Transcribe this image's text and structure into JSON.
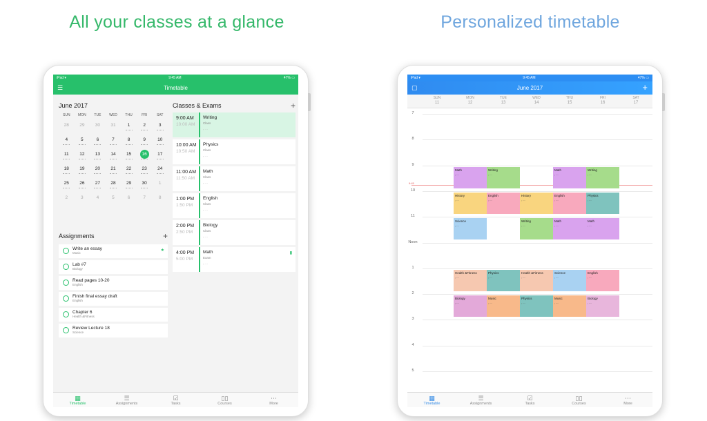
{
  "headlines": {
    "left": "All your classes at a glance",
    "right": "Personalized timetable"
  },
  "left_app": {
    "status": {
      "carrier": "iPad ▾",
      "time": "9:45 AM",
      "battery": "47% ▭"
    },
    "title": "Timetable",
    "calendar": {
      "title": "June 2017",
      "weekdays": [
        "SUN",
        "MON",
        "TUE",
        "WED",
        "THU",
        "FRI",
        "SAT"
      ],
      "days": [
        {
          "d": "28",
          "m": true
        },
        {
          "d": "29",
          "m": true
        },
        {
          "d": "30",
          "m": true
        },
        {
          "d": "31",
          "m": true
        },
        {
          "d": "1"
        },
        {
          "d": "2"
        },
        {
          "d": "3"
        },
        {
          "d": "4"
        },
        {
          "d": "5"
        },
        {
          "d": "6"
        },
        {
          "d": "7"
        },
        {
          "d": "8"
        },
        {
          "d": "9"
        },
        {
          "d": "10"
        },
        {
          "d": "11"
        },
        {
          "d": "12"
        },
        {
          "d": "13"
        },
        {
          "d": "14"
        },
        {
          "d": "15"
        },
        {
          "d": "16",
          "sel": true
        },
        {
          "d": "17"
        },
        {
          "d": "18"
        },
        {
          "d": "19"
        },
        {
          "d": "20"
        },
        {
          "d": "21"
        },
        {
          "d": "22"
        },
        {
          "d": "23"
        },
        {
          "d": "24"
        },
        {
          "d": "25"
        },
        {
          "d": "26"
        },
        {
          "d": "27"
        },
        {
          "d": "28"
        },
        {
          "d": "29"
        },
        {
          "d": "30"
        },
        {
          "d": "1",
          "m": true
        },
        {
          "d": "2",
          "m": true
        },
        {
          "d": "3",
          "m": true
        },
        {
          "d": "4",
          "m": true
        },
        {
          "d": "5",
          "m": true
        },
        {
          "d": "6",
          "m": true
        },
        {
          "d": "7",
          "m": true
        },
        {
          "d": "8",
          "m": true
        }
      ]
    },
    "assignments_title": "Assignments",
    "assignments": [
      {
        "title": "Write an essay",
        "sub": "Music",
        "flag": true
      },
      {
        "title": "Lab #7",
        "sub": "Biology"
      },
      {
        "title": "Read pages 10-20",
        "sub": "English"
      },
      {
        "title": "Finish final essay draft",
        "sub": "English"
      },
      {
        "title": "Chapter 6",
        "sub": "Health &Fitness"
      },
      {
        "title": "Review Lecture 18",
        "sub": "Science"
      }
    ],
    "classes_title": "Classes & Exams",
    "classes": [
      {
        "time": "9:00 AM",
        "end": "10:00 AM",
        "name": "Writing",
        "type": "Class",
        "hl": true
      },
      {
        "time": "10:00 AM",
        "end": "10:50 AM",
        "name": "Physics",
        "type": "Class"
      },
      {
        "time": "11:00 AM",
        "end": "11:50 AM",
        "name": "Math",
        "type": "Class"
      },
      {
        "time": "1:00 PM",
        "end": "1:50 PM",
        "name": "English",
        "type": "Class"
      },
      {
        "time": "2:00 PM",
        "end": "2:50 PM",
        "name": "Biology",
        "type": "Class"
      },
      {
        "time": "4:00 PM",
        "end": "5:00 PM",
        "name": "Math",
        "type": "Exam",
        "flag": true
      }
    ],
    "tabs": [
      "Timetable",
      "Assignments",
      "Tasks",
      "Courses",
      "More"
    ]
  },
  "right_app": {
    "status": {
      "carrier": "iPad ▾",
      "time": "9:45 AM",
      "battery": "47% ▭"
    },
    "title": "June 2017",
    "weekdays": [
      {
        "n": "SUN",
        "d": "11"
      },
      {
        "n": "MON",
        "d": "12"
      },
      {
        "n": "TUE",
        "d": "13"
      },
      {
        "n": "WED",
        "d": "14"
      },
      {
        "n": "THU",
        "d": "15"
      },
      {
        "n": "FRI",
        "d": "16"
      },
      {
        "n": "SAT",
        "d": "17"
      }
    ],
    "hours": [
      "7",
      "8",
      "9",
      "10",
      "11",
      "Noon",
      "1",
      "2",
      "3",
      "4",
      "5"
    ],
    "now_label": "9:45",
    "blocks": [
      {
        "n": "Math",
        "col": 1,
        "row": 2,
        "c": "#d9a3ee"
      },
      {
        "n": "Writing",
        "col": 2,
        "row": 2,
        "c": "#a6dc8b"
      },
      {
        "n": "Math",
        "col": 4,
        "row": 2,
        "c": "#d9a3ee"
      },
      {
        "n": "Writing",
        "col": 5,
        "row": 2,
        "c": "#a6dc8b"
      },
      {
        "n": "History",
        "col": 1,
        "row": 3,
        "c": "#f9d57f"
      },
      {
        "n": "English",
        "col": 2,
        "row": 3,
        "c": "#f8a9bd"
      },
      {
        "n": "History",
        "col": 3,
        "row": 3,
        "c": "#f9d57f"
      },
      {
        "n": "English",
        "col": 4,
        "row": 3,
        "c": "#f8a9bd"
      },
      {
        "n": "Physics",
        "col": 5,
        "row": 3,
        "c": "#7fc3be"
      },
      {
        "n": "Science",
        "col": 1,
        "row": 4,
        "c": "#a9d2f2"
      },
      {
        "n": "Writing",
        "col": 3,
        "row": 4,
        "c": "#a6dc8b"
      },
      {
        "n": "Math",
        "col": 4,
        "row": 4,
        "c": "#d9a3ee"
      },
      {
        "n": "Math",
        "col": 5,
        "row": 4,
        "c": "#d9a3ee"
      },
      {
        "n": "Health &Fitness",
        "col": 1,
        "row": 6,
        "c": "#f6c8b0"
      },
      {
        "n": "Physics",
        "col": 2,
        "row": 6,
        "c": "#7fc3be"
      },
      {
        "n": "Health &Fitness",
        "col": 3,
        "row": 6,
        "c": "#f6c8b0"
      },
      {
        "n": "Science",
        "col": 4,
        "row": 6,
        "c": "#a9d2f2"
      },
      {
        "n": "English",
        "col": 5,
        "row": 6,
        "c": "#f8a9bd"
      },
      {
        "n": "Biology",
        "col": 1,
        "row": 7,
        "c": "#e3a9d9"
      },
      {
        "n": "Music",
        "col": 2,
        "row": 7,
        "c": "#f8b98a"
      },
      {
        "n": "Physics",
        "col": 3,
        "row": 7,
        "c": "#7fc3be"
      },
      {
        "n": "Music",
        "col": 4,
        "row": 7,
        "c": "#f8b98a"
      },
      {
        "n": "Biology",
        "col": 5,
        "row": 7,
        "c": "#e8b6dc"
      }
    ],
    "tabs": [
      "Timetable",
      "Assignments",
      "Tasks",
      "Courses",
      "More"
    ]
  }
}
